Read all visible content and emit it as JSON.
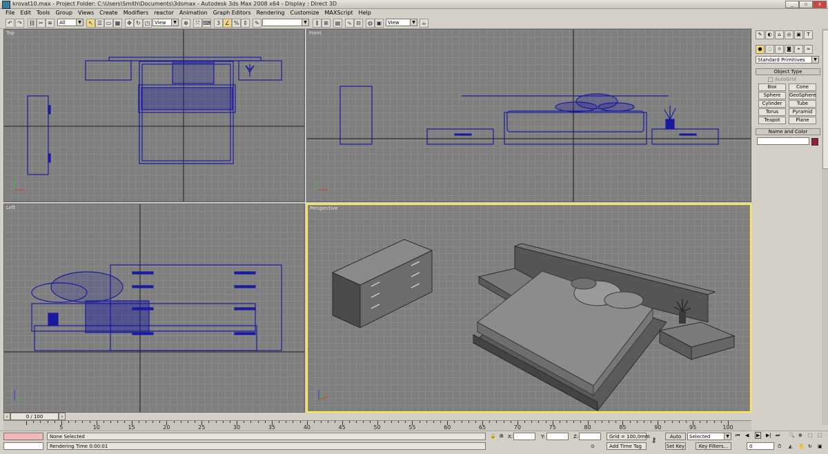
{
  "window": {
    "title": "krovat10.max    - Project Folder: C:\\Users\\Smith\\Documents\\3dsmax    - Autodesk 3ds Max 2008 x64     - Display : Direct 3D"
  },
  "menu": [
    "File",
    "Edit",
    "Tools",
    "Group",
    "Views",
    "Create",
    "Modifiers",
    "reactor",
    "Animation",
    "Graph Editors",
    "Rendering",
    "Customize",
    "MAXScript",
    "Help"
  ],
  "toolbar": {
    "selection_filter": "All",
    "ref_coord_1": "View",
    "named_selection": "",
    "ref_coord_2": "View"
  },
  "viewports": {
    "top": "Top",
    "front": "Front",
    "left": "Left",
    "perspective": "Perspective"
  },
  "command_panel": {
    "category": "Standard Primitives",
    "object_type_header": "Object Type",
    "autogrid": "AutoGrid",
    "buttons": [
      "Box",
      "Cone",
      "Sphere",
      "GeoSphere",
      "Cylinder",
      "Tube",
      "Torus",
      "Pyramid",
      "Teapot",
      "Plane"
    ],
    "name_color_header": "Name and Color",
    "object_color": "#9c1a3c"
  },
  "timeline": {
    "frame": "0 / 100",
    "ticks": [
      "5",
      "10",
      "15",
      "20",
      "25",
      "30",
      "35",
      "40",
      "45",
      "50",
      "55",
      "60",
      "65",
      "70",
      "75",
      "80",
      "85",
      "90",
      "95",
      "100"
    ]
  },
  "status": {
    "selection": "None Selected",
    "prompt": "Rendering Time  0:00:01",
    "x_label": "X:",
    "y_label": "Y:",
    "z_label": "Z:",
    "grid": "Grid = 100,0mm",
    "add_time_tag": "Add Time Tag",
    "auto_key": "Auto Key",
    "set_key": "Set Key",
    "key_mode": "Selected",
    "key_filters": "Key Filters...",
    "current_frame": "0"
  }
}
